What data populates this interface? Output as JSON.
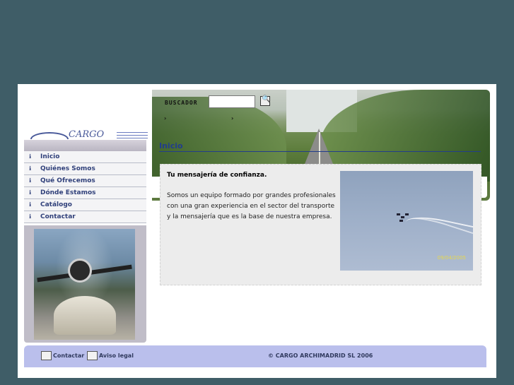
{
  "logo": {
    "text": "CARGO"
  },
  "search": {
    "label": "BUSCADOR",
    "placeholder": "",
    "button_icon": "magnifier-icon"
  },
  "breadcrumbs": [
    "",
    ""
  ],
  "nav": {
    "items": [
      {
        "label": "Inicio"
      },
      {
        "label": "Quiénes Somos"
      },
      {
        "label": "Qué Ofrecemos"
      },
      {
        "label": "Dónde Estamos"
      },
      {
        "label": "Catálogo"
      },
      {
        "label": "Contactar"
      }
    ]
  },
  "main": {
    "section_title": "Inicio",
    "heading": "Tu mensajería de confianza.",
    "body": "Somos un equipo formado por grandes profesionales con una gran experiencia en el sector del transporte y la mensajería que es la base de nuestra empresa.",
    "photo_date": "09/04/2005"
  },
  "footer": {
    "contact": "Contactar",
    "legal": "Aviso legal",
    "copyright": "© CARGO ARCHIMADRID SL 2006"
  },
  "colors": {
    "background": "#3f5d67",
    "nav_text": "#30407a",
    "title": "#223d8c",
    "footer_bg": "#babfec"
  }
}
